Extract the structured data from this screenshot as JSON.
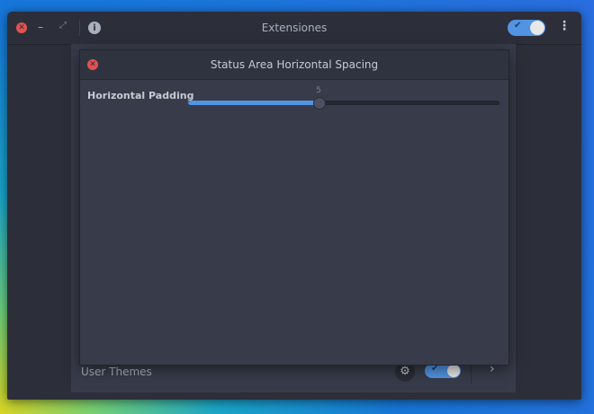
{
  "window": {
    "title": "Extensiones",
    "close_symbol": "✕",
    "minimize_symbol": "–",
    "maximize_symbol": "⤢",
    "info_symbol": "i",
    "menu_symbol": "⋮",
    "global_toggle_on": true
  },
  "extensions": {
    "rows": [
      {
        "name": "User Themes",
        "enabled": true
      }
    ]
  },
  "dialog": {
    "title": "Status Area Horizontal Spacing",
    "close_symbol": "✕",
    "setting_label": "Horizontal Padding",
    "slider": {
      "value": "5",
      "min": 0,
      "max": 12,
      "fraction": 0.42
    }
  },
  "colors": {
    "accent": "#5294e2",
    "close_red": "#e25252",
    "window_bg": "#2c2f3a",
    "content_bg": "#383c4a"
  },
  "icons": {
    "check": "✔",
    "gear": "⚙",
    "arrow": "›"
  }
}
